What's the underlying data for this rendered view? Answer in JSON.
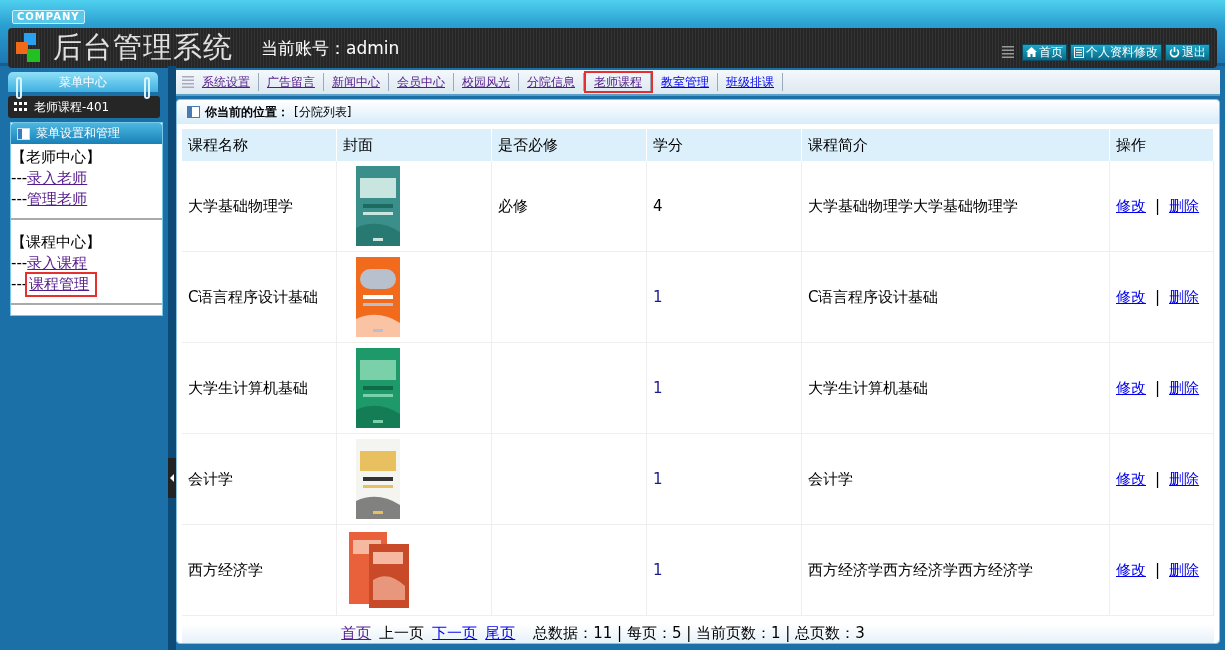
{
  "header": {
    "company": "COMPANY",
    "title": "后台管理系统",
    "account": "当前账号：admin",
    "buttons": [
      {
        "kind": "home",
        "label": "首页"
      },
      {
        "kind": "profile",
        "label": "个人资料修改"
      },
      {
        "kind": "logout",
        "label": "退出"
      }
    ]
  },
  "sidebar": {
    "title": "菜单中心",
    "current": "老师课程-401",
    "panel_title": "菜单设置和管理",
    "groups": [
      {
        "title": "【老师中心】",
        "items": [
          {
            "prefix": "---",
            "label": "录入老师",
            "selected": false
          },
          {
            "prefix": "---",
            "label": "管理老师",
            "selected": false
          }
        ]
      },
      {
        "title": "【课程中心】",
        "items": [
          {
            "prefix": "---",
            "label": "录入课程",
            "selected": false
          },
          {
            "prefix": "---",
            "label": "课程管理",
            "selected": true
          }
        ]
      }
    ]
  },
  "tabs": [
    {
      "label": "系统设置",
      "visited": true,
      "selected": false
    },
    {
      "label": "广告留言",
      "visited": true,
      "selected": false
    },
    {
      "label": "新闻中心",
      "visited": true,
      "selected": false
    },
    {
      "label": "会员中心",
      "visited": true,
      "selected": false
    },
    {
      "label": "校园风光",
      "visited": true,
      "selected": false
    },
    {
      "label": "分院信息",
      "visited": true,
      "selected": false
    },
    {
      "label": "老师课程",
      "visited": true,
      "selected": true
    },
    {
      "label": "教室管理",
      "visited": false,
      "selected": false
    },
    {
      "label": "班级排课",
      "visited": false,
      "selected": false
    }
  ],
  "breadcrumb": {
    "label": "你当前的位置：",
    "value": "[分院列表]"
  },
  "table": {
    "columns": [
      "课程名称",
      "封面",
      "是否必修",
      "学分",
      "课程简介",
      "操作"
    ],
    "rows": [
      {
        "name": "大学基础物理学",
        "required": "必修",
        "credit": {
          "text": "4",
          "color": "#000000"
        },
        "intro": "大学基础物理学大学基础物理学",
        "actions": [
          "修改",
          "|",
          "删除"
        ]
      },
      {
        "name": "C语言程序设计基础",
        "credit": {
          "text": "1",
          "color": "#1a1a8c"
        },
        "intro": "C语言程序设计基础",
        "actions": [
          "修改",
          "|",
          "删除"
        ]
      },
      {
        "name": "大学生计算机基础",
        "credit": {
          "text": "1",
          "color": "#1a1a8c"
        },
        "intro": "大学生计算机基础",
        "actions": [
          "修改",
          "|",
          "删除"
        ]
      },
      {
        "name": "会计学",
        "credit": {
          "text": "1",
          "color": "#1a1a8c"
        },
        "intro": "会计学",
        "actions": [
          "修改",
          "|",
          "删除"
        ]
      },
      {
        "name": "西方经济学",
        "credit": {
          "text": "1",
          "color": "#1a1a8c"
        },
        "intro": "西方经济学西方经济学西方经济学",
        "actions": [
          "修改",
          "|",
          "删除"
        ]
      }
    ]
  },
  "pager": [
    {
      "kind": "link",
      "label": "首页",
      "visited": true
    },
    {
      "kind": "text",
      "label": "上一页"
    },
    {
      "kind": "link",
      "label": "下一页",
      "visited": false
    },
    {
      "kind": "link",
      "label": "尾页",
      "visited": false
    },
    {
      "kind": "stats",
      "label": "总数据：11 | 每页：5 | 当前页数：1 | 总页数：3"
    }
  ]
}
